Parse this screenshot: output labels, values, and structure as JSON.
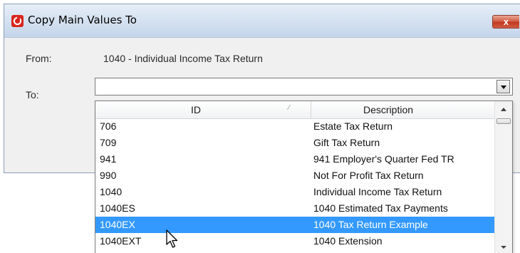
{
  "window": {
    "title": "Copy Main Values To",
    "close_label": "x"
  },
  "form": {
    "from_label": "From:",
    "from_value": "1040 - Individual Income Tax Return",
    "to_label": "To:",
    "to_value": ""
  },
  "grid": {
    "columns": [
      "ID",
      "Description"
    ],
    "sort_indicator": "⁄",
    "rows": [
      {
        "id": "706",
        "description": "Estate Tax Return"
      },
      {
        "id": "709",
        "description": "Gift Tax Return"
      },
      {
        "id": "941",
        "description": "941 Employer's Quarter Fed TR"
      },
      {
        "id": "990",
        "description": "Not For Profit Tax Return"
      },
      {
        "id": "1040",
        "description": "Individual Income Tax Return"
      },
      {
        "id": "1040ES",
        "description": "1040 Estimated Tax Payments"
      },
      {
        "id": "1040EX",
        "description": "1040 Tax Return Example"
      },
      {
        "id": "1040EXT",
        "description": "1040 Extension"
      }
    ],
    "selected_row": 6
  },
  "icons": {
    "app": "app-logo-icon",
    "close": "close-icon",
    "combo_arrow": "chevron-down-icon",
    "scroll_up": "scroll-up-arrow-icon",
    "scroll_down": "scroll-down-arrow-icon",
    "cursor": "mouse-pointer-icon"
  },
  "colors": {
    "selection": "#3399ff",
    "title_bar": "#d3e0f0",
    "close_button": "#c0391f",
    "app_icon": "#d8261e"
  }
}
